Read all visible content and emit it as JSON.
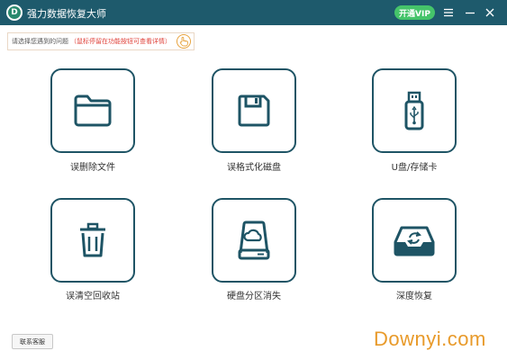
{
  "window": {
    "title": "强力数据恢复大师",
    "logo_letter": "D",
    "vip_label": "开通VIP",
    "controls": [
      "menu-icon",
      "minimize-icon",
      "close-icon"
    ]
  },
  "hint": {
    "main": "请选择您遇到的问题",
    "detail": "（鼠标停留在功能按钮可查看详情）",
    "icon": "pointer-hand-icon"
  },
  "tiles": [
    {
      "label": "误删除文件",
      "icon": "folder-icon"
    },
    {
      "label": "误格式化磁盘",
      "icon": "floppy-disk-icon"
    },
    {
      "label": "U盘/存储卡",
      "icon": "usb-drive-icon"
    },
    {
      "label": "误清空回收站",
      "icon": "trash-bin-icon"
    },
    {
      "label": "硬盘分区消失",
      "icon": "hard-disk-icon"
    },
    {
      "label": "深度恢复",
      "icon": "deep-recovery-icon"
    }
  ],
  "footer": {
    "contact_label": "联系客服",
    "watermark": "Downyi.com"
  },
  "colors": {
    "titlebar": "#1e5a6c",
    "accent_green": "#45c46a",
    "tile_border": "#1e5465",
    "hint_red": "#e0443c",
    "watermark": "#e89a2a"
  }
}
